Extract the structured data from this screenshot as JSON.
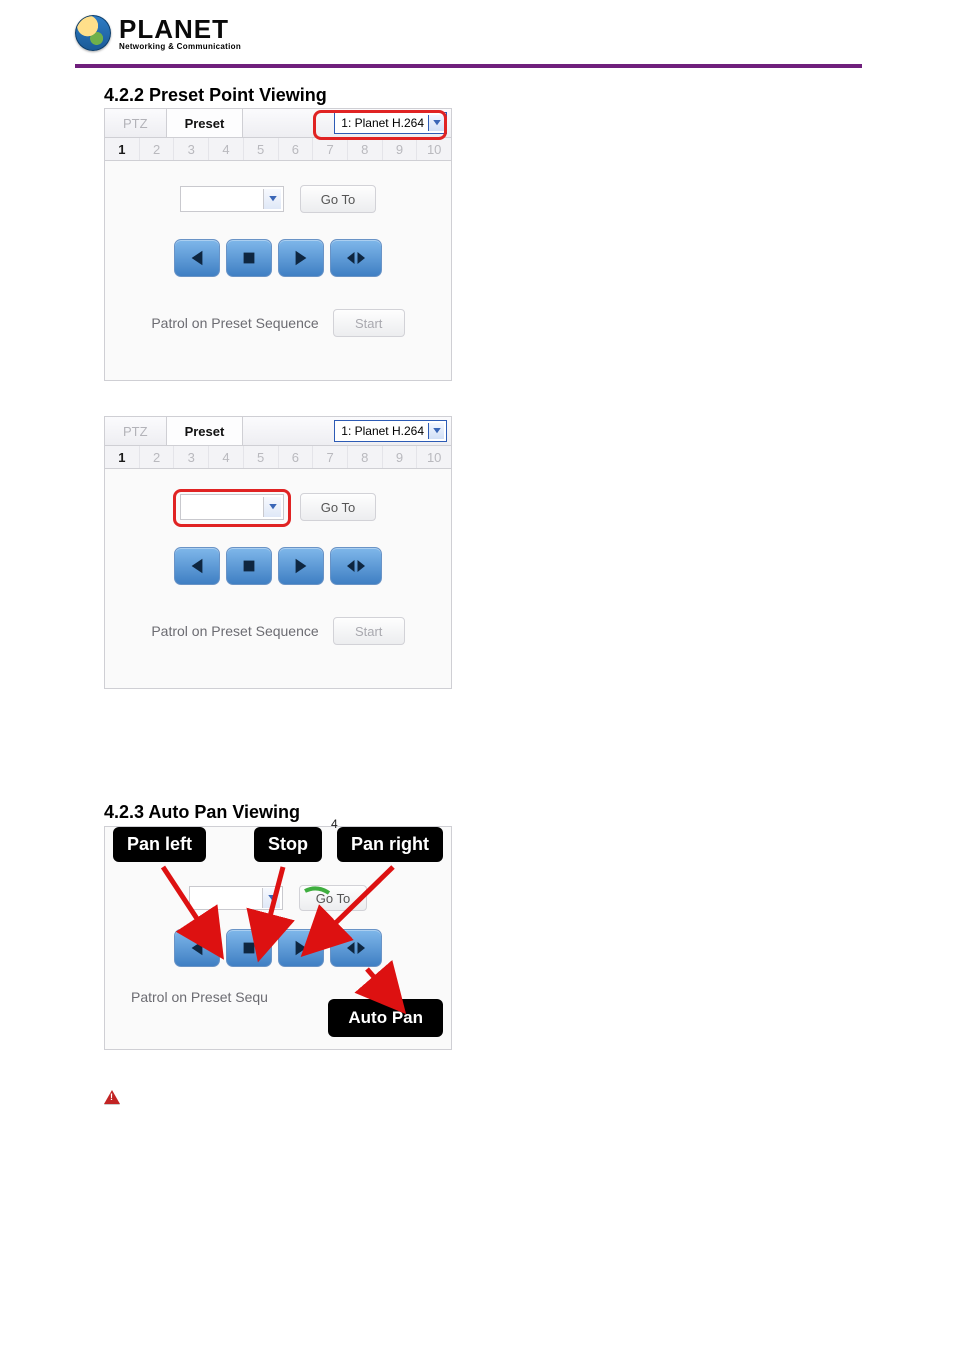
{
  "logo": {
    "brand": "PLANET",
    "tagline": "Networking & Communication"
  },
  "section_422": "4.2.2 Preset Point Viewing",
  "section_423": "4.2.3 Auto Pan Viewing",
  "panel": {
    "tabs": {
      "ptz": "PTZ",
      "preset": "Preset"
    },
    "camera_selected": "1: Planet H.264",
    "numbers": [
      "1",
      "2",
      "3",
      "4",
      "5",
      "6",
      "7",
      "8",
      "9",
      "10"
    ],
    "active_index": 0,
    "preset_select_value": "",
    "goto": "Go To",
    "patrol_label": "Patrol on Preset Sequence",
    "start": "Start"
  },
  "autopan": {
    "labels": {
      "pan_left": "Pan left",
      "stop": "Stop",
      "pan_right": "Pan right",
      "index": "4",
      "auto_pan": "Auto Pan"
    },
    "goto": "Go To",
    "patrol_label": "Patrol on Preset Sequ"
  },
  "icons": {
    "dropdown": "chevron-down-icon",
    "prev": "play-prev-icon",
    "stop": "stop-icon",
    "play": "play-icon",
    "step": "step-icon",
    "warn": "warning-icon"
  }
}
